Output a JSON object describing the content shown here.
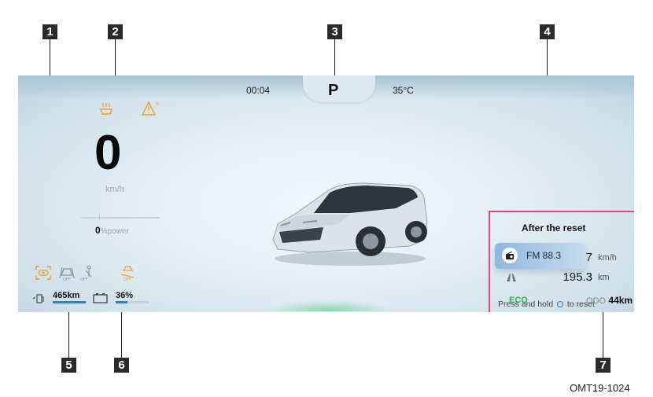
{
  "callouts": {
    "c1": "1",
    "c2": "2",
    "c3": "3",
    "c4": "4",
    "c5": "5",
    "c6": "6",
    "c7": "7"
  },
  "header": {
    "clock": "00:04",
    "gear": "P",
    "temperature": "35°C"
  },
  "speed": {
    "value": "0",
    "unit": "km/h"
  },
  "power": {
    "value": "0",
    "unit": "%power",
    "fraction": 0
  },
  "reset_panel": {
    "title": "After the reset",
    "avg_speed": {
      "value": "87",
      "unit": "km/h"
    },
    "distance": {
      "value": "195.3",
      "unit": "km"
    },
    "hint_before": "Press and hold",
    "hint_after": "to reset"
  },
  "radio": {
    "station": "FM 88.3"
  },
  "range": {
    "value": "465km",
    "fraction": 0.95
  },
  "battery": {
    "value": "36%",
    "fraction": 0.36
  },
  "drive_mode": "ECO",
  "odometer": {
    "label": "ODO",
    "value": "44km"
  },
  "figure_code": "OMT19-1024",
  "icons": [
    "seat-heat-icon",
    "warning-triangle-icon",
    "driver-monitor-icon",
    "lane-assist-off-icon",
    "seatbelt-off-icon",
    "hill-descent-icon",
    "fuel-pump-icon",
    "battery-icon",
    "radio-icon",
    "gauge-icon",
    "road-icon",
    "circle-button-icon",
    "car-image"
  ],
  "colors": {
    "callout_box": "#2b2b2b",
    "highlight_border": "#e0457b",
    "warning_orange": "#f0a030",
    "eco_green": "#2fb34a",
    "bar_blue": "#2d7fd0"
  }
}
